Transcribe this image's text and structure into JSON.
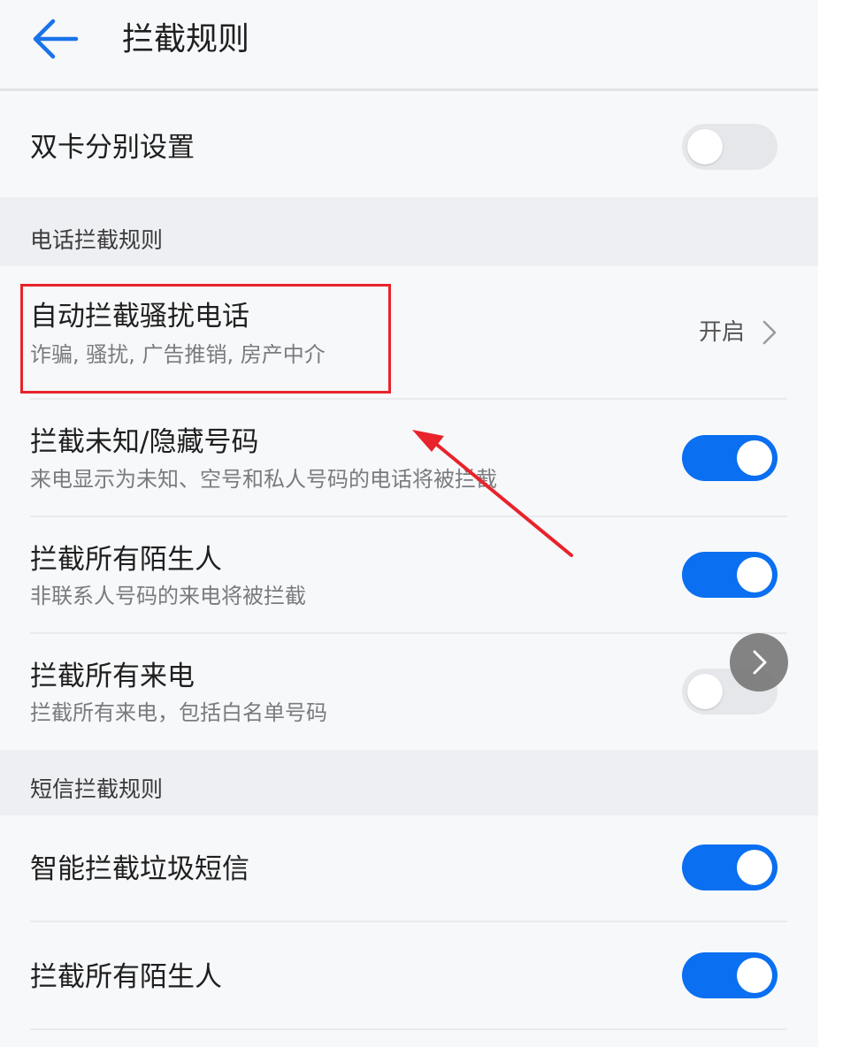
{
  "header": {
    "title": "拦截规则",
    "back_icon": "arrow-left-icon"
  },
  "dual_sim": {
    "label": "双卡分别设置",
    "enabled": false
  },
  "call_rules": {
    "section_label": "电话拦截规则",
    "auto_block": {
      "title": "自动拦截骚扰电话",
      "subtitle": "诈骗, 骚扰, 广告推销, 房产中介",
      "status": "开启"
    },
    "unknown_hidden": {
      "title": "拦截未知/隐藏号码",
      "subtitle": "来电显示为未知、空号和私人号码的电话将被拦截",
      "enabled": true
    },
    "all_strangers": {
      "title": "拦截所有陌生人",
      "subtitle": "非联系人号码的来电将被拦截",
      "enabled": true
    },
    "all_calls": {
      "title": "拦截所有来电",
      "subtitle": "拦截所有来电，包括白名单号码",
      "enabled": false
    }
  },
  "sms_rules": {
    "section_label": "短信拦截规则",
    "smart_spam": {
      "title": "智能拦截垃圾短信",
      "enabled": true
    },
    "all_strangers": {
      "title": "拦截所有陌生人",
      "enabled": true
    }
  },
  "colors": {
    "accent": "#0a6ff0",
    "annotation": "#e8232b"
  }
}
